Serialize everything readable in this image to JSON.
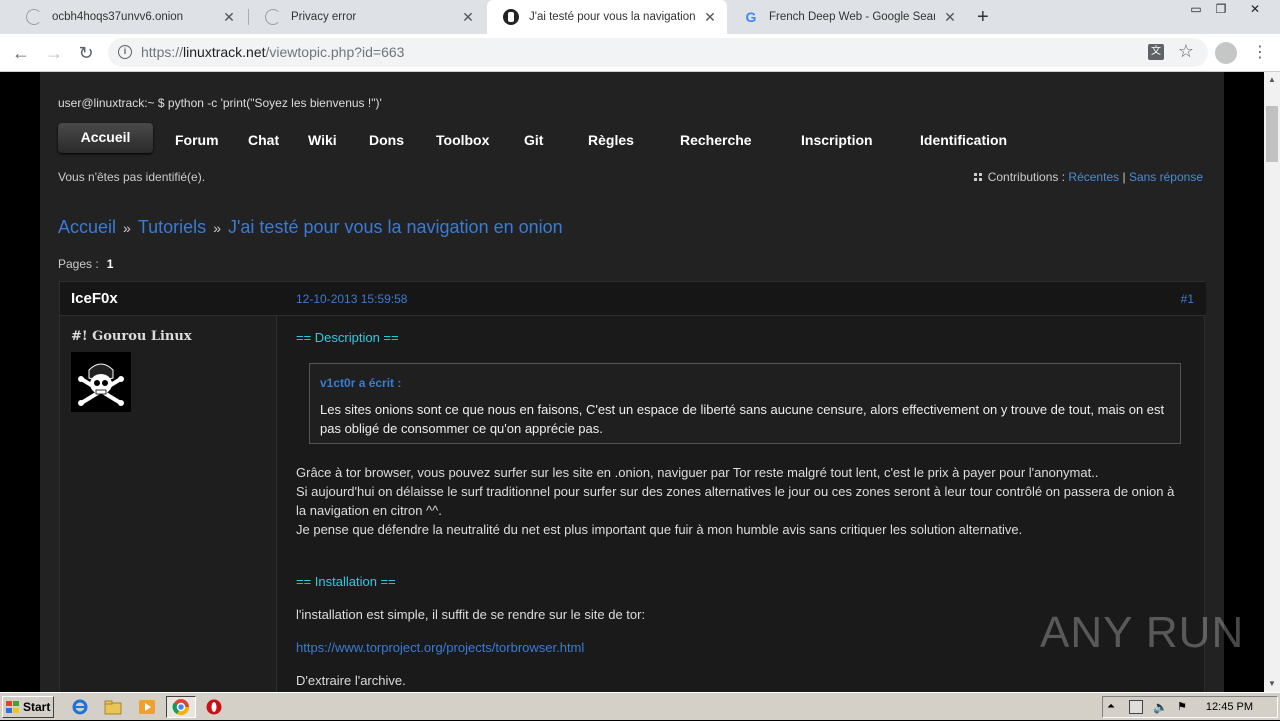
{
  "browser": {
    "tabs": [
      {
        "title": "ocbh4hoqs37unvv6.onion",
        "loading": true,
        "active": false
      },
      {
        "title": "Privacy error",
        "loading": true,
        "active": false
      },
      {
        "title": "J'ai testé pour vous la navigation en",
        "loading": false,
        "active": true
      },
      {
        "title": "French Deep Web - Google Search",
        "loading": false,
        "active": false
      }
    ],
    "new_tab_icon": "+",
    "url_scheme": "https://",
    "url_host": "linuxtrack.net",
    "url_path": "/viewtopic.php?id=663"
  },
  "site": {
    "shell_prompt": "user@linuxtrack:~ $ python -c 'print(\"Soyez les bienvenus !\")'",
    "nav": {
      "home": "Accueil",
      "items": [
        "Forum",
        "Chat",
        "Wiki",
        "Dons",
        "Toolbox",
        "Git",
        "Règles",
        "Recherche",
        "Inscription",
        "Identification"
      ]
    },
    "not_identified": "Vous n'êtes pas identifié(e).",
    "contributions": {
      "label": "Contributions :",
      "recent": "Récentes",
      "sep": "|",
      "no_reply": "Sans réponse"
    },
    "breadcrumb": {
      "home": "Accueil",
      "section": "Tutoriels",
      "topic": "J'ai testé pour vous la navigation en onion",
      "sep": "»"
    },
    "pages": {
      "label": "Pages :",
      "current": "1"
    }
  },
  "post": {
    "author": "IceF0x",
    "date": "12-10-2013 15:59:58",
    "number": "#1",
    "rank": "#! Gourou Linux",
    "description_header": "== Description ==",
    "quote_author": "v1ct0r a écrit :",
    "quote_text": "Les sites onions sont ce que nous en faisons, C'est un espace de liberté sans aucune censure, alors effectivement on y trouve de tout, mais on est pas obligé de consommer ce qu'on apprécie pas.",
    "para1_line1": "Grâce à tor browser, vous pouvez surfer sur les site en .onion, naviguer par Tor reste malgré tout lent, c'est le prix à payer pour l'anonymat..",
    "para1_line2": "Si aujourd'hui on délaisse le surf traditionnel pour surfer sur des zones alternatives le jour ou ces zones seront à leur tour contrôlé on passera de onion à la navigation en citron ^^.",
    "para1_line3": "Je pense que défendre la neutralité du net est plus important que fuir à mon humble avis sans critiquer les solution alternative.",
    "install_header": "== Installation ==",
    "install_text": "l'installation est simple, il suffit de se rendre sur le site de tor:",
    "install_link": "https://www.torproject.org/projects/torbrowser.html",
    "extract_text": "D'extraire l'archive."
  },
  "watermark": "ANY RUN",
  "taskbar": {
    "start_label": "Start",
    "clock": "12:45 PM"
  }
}
